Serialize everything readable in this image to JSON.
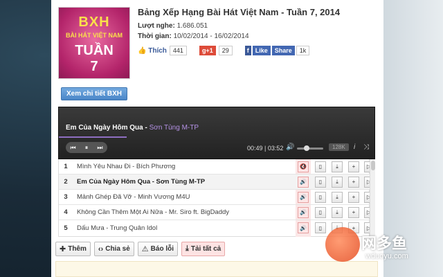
{
  "album": {
    "cover_lines": [
      "BXH",
      "BÀI HÁT VIỆT NAM",
      "TUẦN",
      "7"
    ],
    "title": "Bảng Xếp Hạng Bài Hát Việt Nam - Tuần 7, 2014",
    "listens_label": "Lượt nghe:",
    "listens_value": "1.686.051",
    "time_label": "Thời gian:",
    "time_value": "10/02/2014 - 16/02/2014",
    "detail_button": "Xem chi tiết BXH"
  },
  "social": {
    "like_label": "Thích",
    "like_count": "441",
    "gplus_label": "g+1",
    "gplus_count": "29",
    "fb_like": "Like",
    "fb_share": "Share",
    "fb_count": "1k"
  },
  "player": {
    "song": "Em Của Ngày Hôm Qua",
    "separator": "-",
    "artist": "Sơn Tùng M-TP",
    "time": "00:49 | 03:52",
    "quality": "128K",
    "info_icon": "i",
    "shuffle_icon": "⤨"
  },
  "playlist": [
    {
      "num": "1",
      "name": "Mình Yêu Nhau Đi - Bích Phương"
    },
    {
      "num": "2",
      "name": "Em Của Ngày Hôm Qua - Sơn Tùng M-TP"
    },
    {
      "num": "3",
      "name": "Mảnh Ghép Đã Vỡ - Minh Vương M4U"
    },
    {
      "num": "4",
      "name": "Không Cần Thêm Một Ai Nữa - Mr. Siro ft. BigDaddy"
    },
    {
      "num": "5",
      "name": "Dấu Mưa - Trung Quân Idol"
    }
  ],
  "actions": {
    "add": "Thêm",
    "share": "Chia sẻ",
    "report": "Báo lỗi",
    "download_all": "Tải tất cả"
  },
  "watermark": {
    "brand": "网多鱼",
    "url": "wduoyu.com"
  }
}
